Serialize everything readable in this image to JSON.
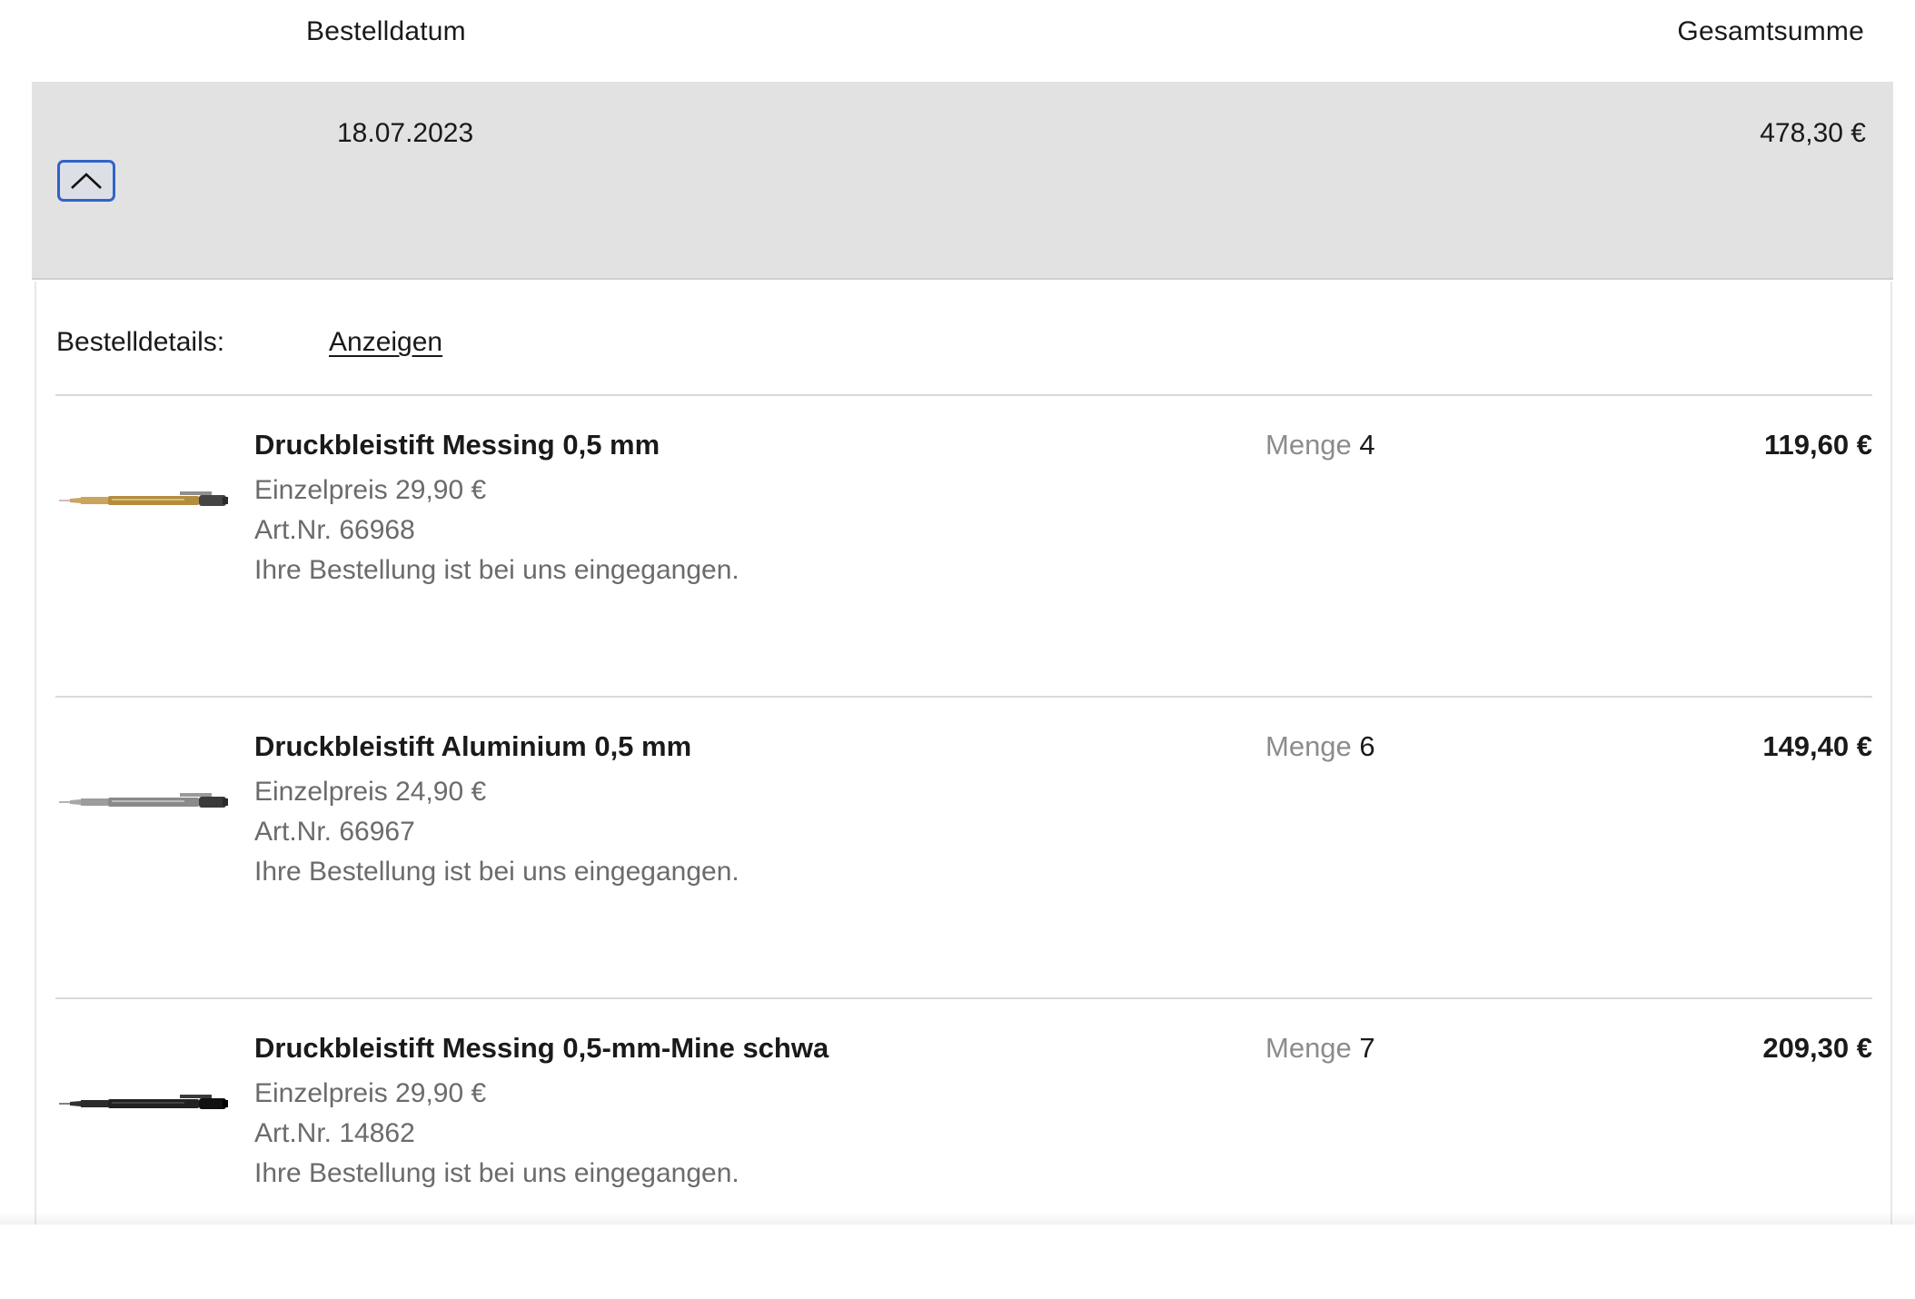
{
  "columns": {
    "order_date_header": "Bestelldatum",
    "total_header": "Gesamtsumme"
  },
  "order": {
    "date": "18.07.2023",
    "total": "478,30 €",
    "toggle_icon": "chevron-up-icon"
  },
  "details": {
    "label": "Bestelldetails:",
    "link_text": "Anzeigen"
  },
  "items": [
    {
      "name": "Druckbleistift Messing 0,5 mm",
      "unit_price": "Einzelpreis 29,90 €",
      "article_no": "Art.Nr. 66968",
      "status": "Ihre Bestellung ist bei uns eingegangen.",
      "qty_label": "Menge",
      "qty": "4",
      "price": "119,60 €",
      "image": "brass-pencil-image",
      "body_color": "#b38d3e"
    },
    {
      "name": "Druckbleistift Aluminium 0,5 mm",
      "unit_price": "Einzelpreis 24,90 €",
      "article_no": "Art.Nr. 66967",
      "status": "Ihre Bestellung ist bei uns eingegangen.",
      "qty_label": "Menge",
      "qty": "6",
      "price": "149,40 €",
      "image": "aluminium-pencil-image",
      "body_color": "#8a8a8a"
    },
    {
      "name": "Druckbleistift Messing 0,5-mm-Mine schwa",
      "unit_price": "Einzelpreis 29,90 €",
      "article_no": "Art.Nr. 14862",
      "status": "Ihre Bestellung ist bei uns eingegangen.",
      "qty_label": "Menge",
      "qty": "7",
      "price": "209,30 €",
      "image": "black-pencil-image",
      "body_color": "#222222"
    }
  ]
}
